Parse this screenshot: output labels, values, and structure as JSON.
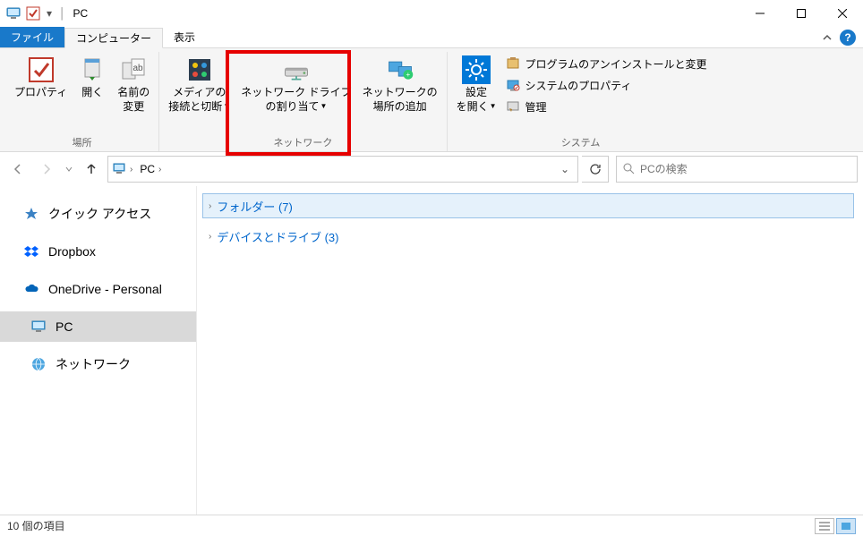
{
  "window": {
    "title": "PC"
  },
  "tabs": {
    "file": "ファイル",
    "computer": "コンピューター",
    "view": "表示"
  },
  "ribbon": {
    "group1": {
      "label": "場所",
      "properties": "プロパティ",
      "open": "開く",
      "rename": "名前の\n変更"
    },
    "group2": {
      "label": "ネットワーク",
      "media": "メディアの\n接続と切断",
      "mapdrive": "ネットワーク ドライブ\nの割り当て",
      "addloc": "ネットワークの\n場所の追加"
    },
    "group3": {
      "label": "システム",
      "settings": "設定\nを開く",
      "uninstall": "プログラムのアンインストールと変更",
      "sysprops": "システムのプロパティ",
      "manage": "管理"
    }
  },
  "address": {
    "location": "PC"
  },
  "search": {
    "placeholder": "PCの検索"
  },
  "sidebar": {
    "quickaccess": "クイック アクセス",
    "dropbox": "Dropbox",
    "onedrive": "OneDrive - Personal",
    "pc": "PC",
    "network": "ネットワーク"
  },
  "content": {
    "folders": "フォルダー (7)",
    "devices": "デバイスとドライブ (3)"
  },
  "status": {
    "items": "10 個の項目"
  }
}
